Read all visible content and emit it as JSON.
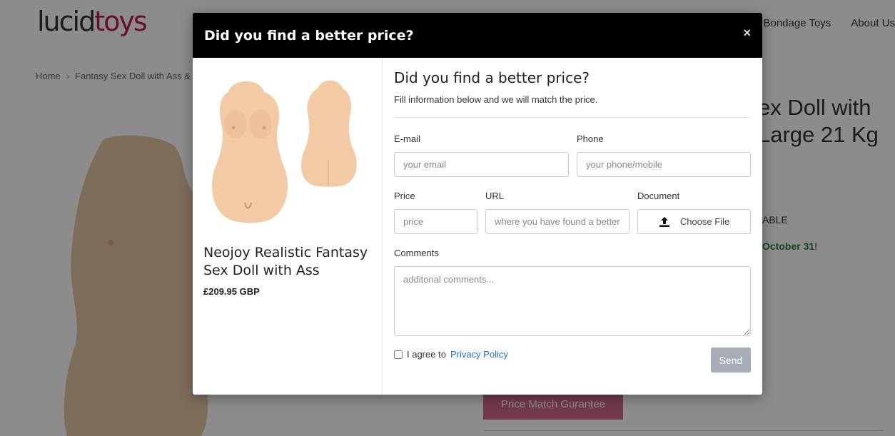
{
  "site": {
    "logo_main": "lucid",
    "logo_accent": "toys",
    "nav": [
      "Bondage Toys",
      "About Us"
    ],
    "breadcrumb": [
      "Home",
      "Fantasy Sex Doll with Ass &"
    ],
    "product_title_line1": "ex Doll with",
    "product_title_line2": "Large 21 Kg",
    "availability": "ABLE",
    "shipping_note": "October 31",
    "price_match_button": "Price Match Gurantee"
  },
  "modal": {
    "title": "Did you find a better price?",
    "close_symbol": "×",
    "product": {
      "name": "Neojoy Realistic Fantasy Sex Doll with Ass",
      "price": "£209.95 GBP"
    },
    "form": {
      "heading": "Did you find a better price?",
      "subheading": "Fill information below and we will match the price.",
      "email_label": "E-mail",
      "email_placeholder": "your email",
      "phone_label": "Phone",
      "phone_placeholder": "your phone/mobile",
      "price_label": "Price",
      "price_placeholder": "price",
      "url_label": "URL",
      "url_placeholder": "where you have found a better price",
      "document_label": "Document",
      "file_button": "Choose File",
      "comments_label": "Comments",
      "comments_placeholder": "additonal comments...",
      "agree_text": "I agree to",
      "privacy_link": "Privacy Policy",
      "send_button": "Send"
    }
  },
  "colors": {
    "header_bg": "#000000",
    "brand_pink": "#c2185b",
    "link_blue": "#1a73c8",
    "send_disabled": "#a6adb4",
    "ship_green": "#2e7d32"
  }
}
